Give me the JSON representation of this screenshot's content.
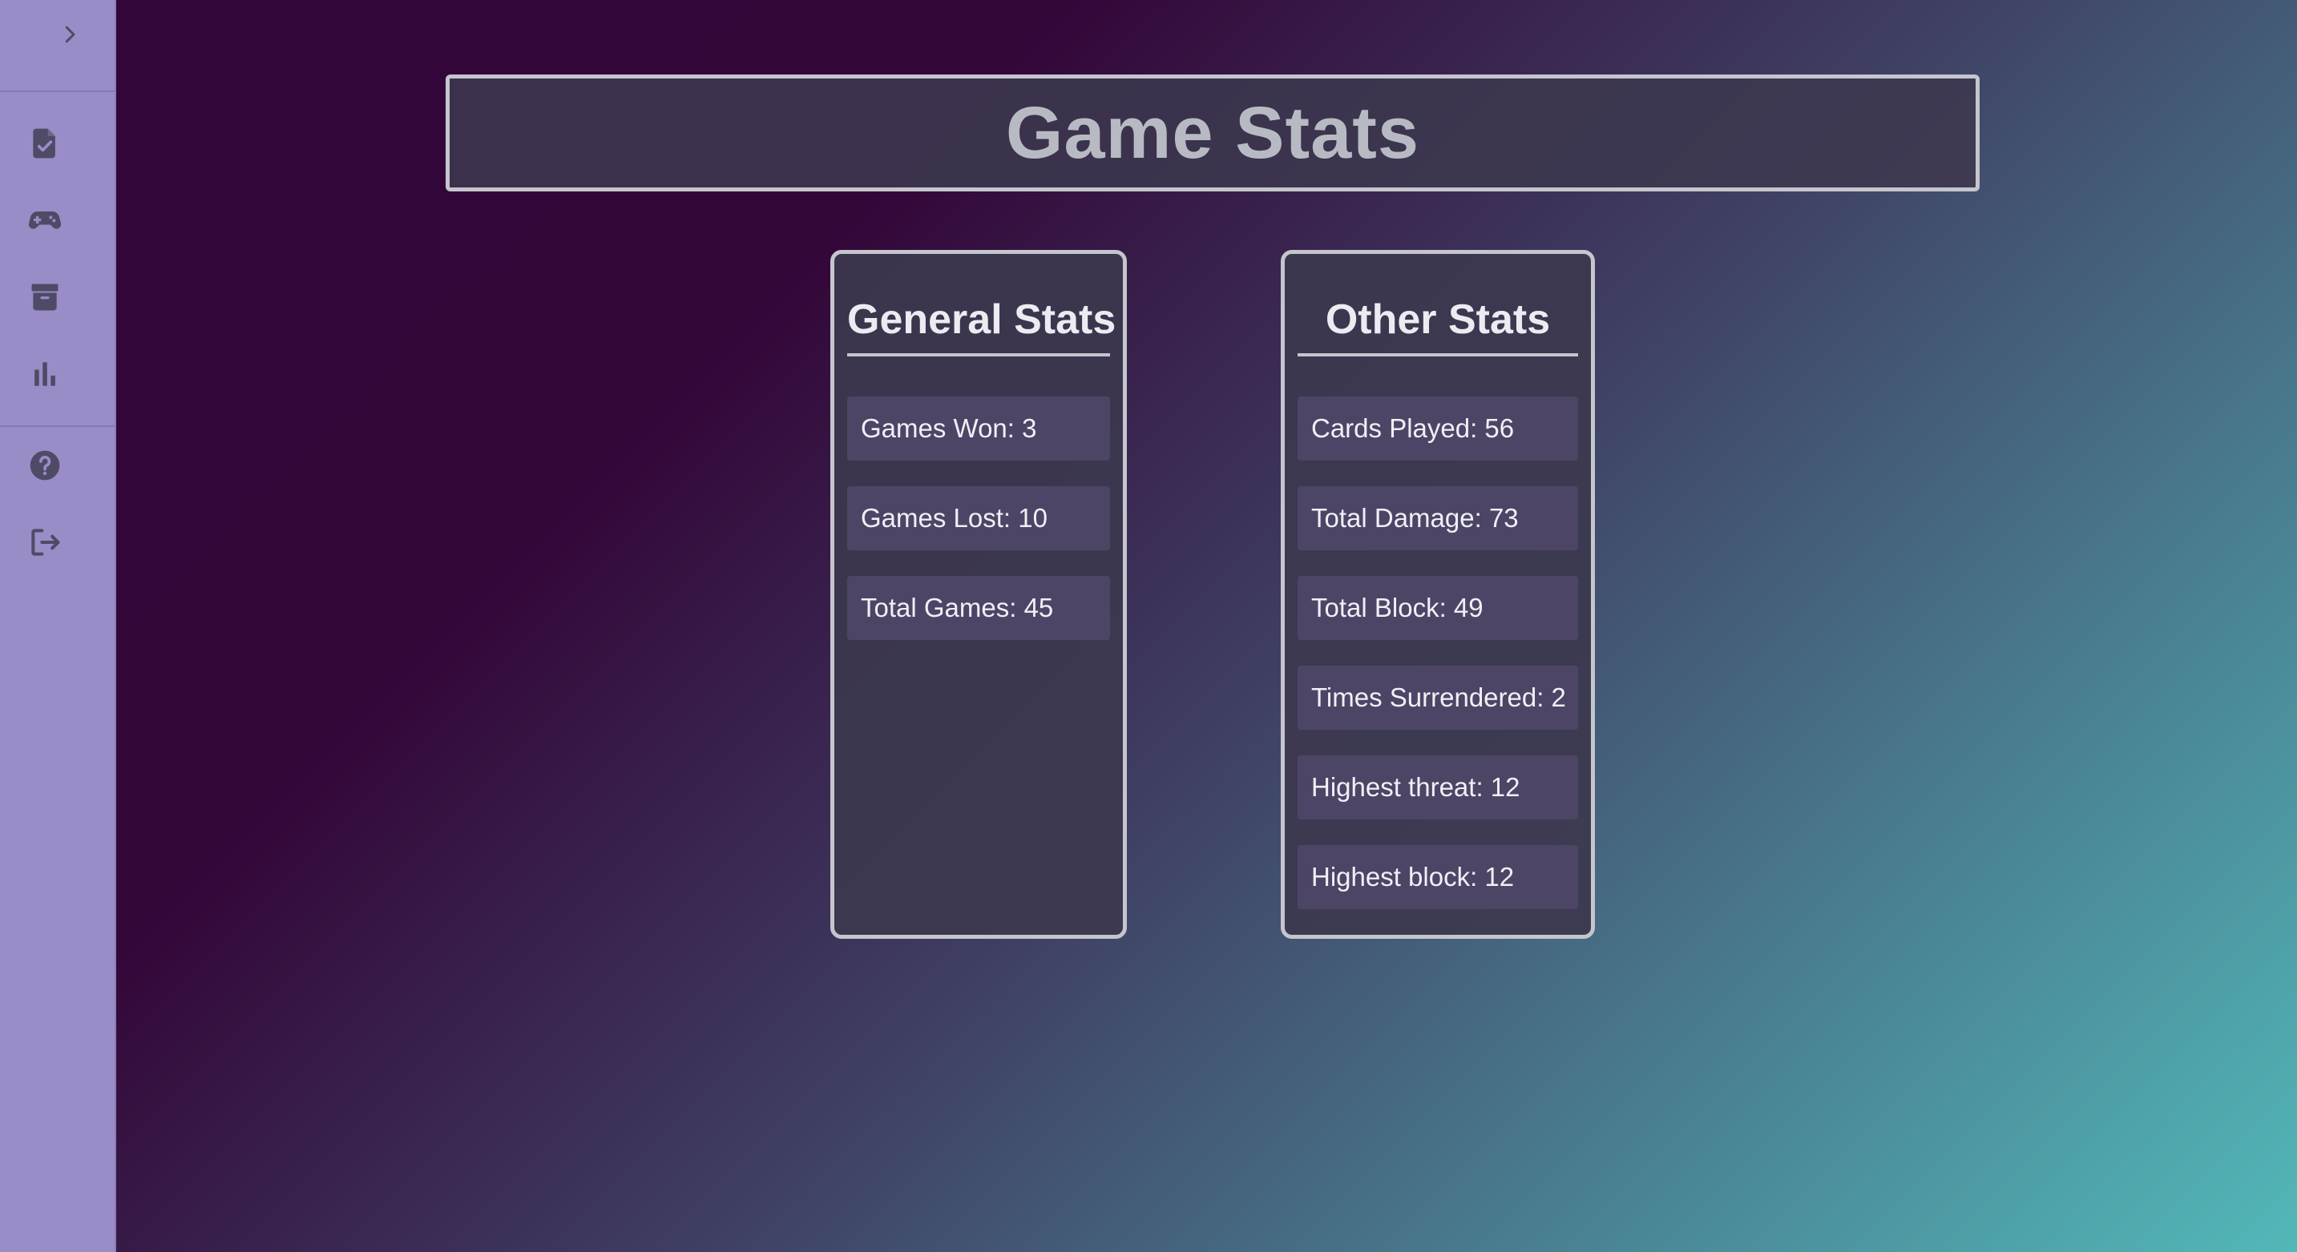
{
  "app": {
    "title": "Game Stats"
  },
  "sidebar": {
    "toggle_icon": "chevron-right-icon",
    "items": [
      {
        "id": "tasks",
        "icon": "file-check-icon"
      },
      {
        "id": "game",
        "icon": "gamepad-icon"
      },
      {
        "id": "archive",
        "icon": "archive-icon"
      },
      {
        "id": "stats",
        "icon": "bar-chart-icon"
      },
      {
        "id": "help",
        "icon": "help-circle-icon"
      },
      {
        "id": "logout",
        "icon": "logout-icon"
      }
    ],
    "colors": {
      "background": "#9a8cc6",
      "icon": "#4f4a66"
    }
  },
  "general": {
    "title": "General Stats",
    "items": [
      {
        "label": "Games Won: 3"
      },
      {
        "label": "Games Lost: 10"
      },
      {
        "label": "Total Games: 45"
      }
    ]
  },
  "other": {
    "title": "Other Stats",
    "items": [
      {
        "label": "Cards Played: 56"
      },
      {
        "label": "Total Damage: 73"
      },
      {
        "label": "Total Block: 49"
      },
      {
        "label": "Times Surrendered: 2"
      },
      {
        "label": "Highest threat: 12"
      },
      {
        "label": "Highest block: 12"
      }
    ]
  }
}
